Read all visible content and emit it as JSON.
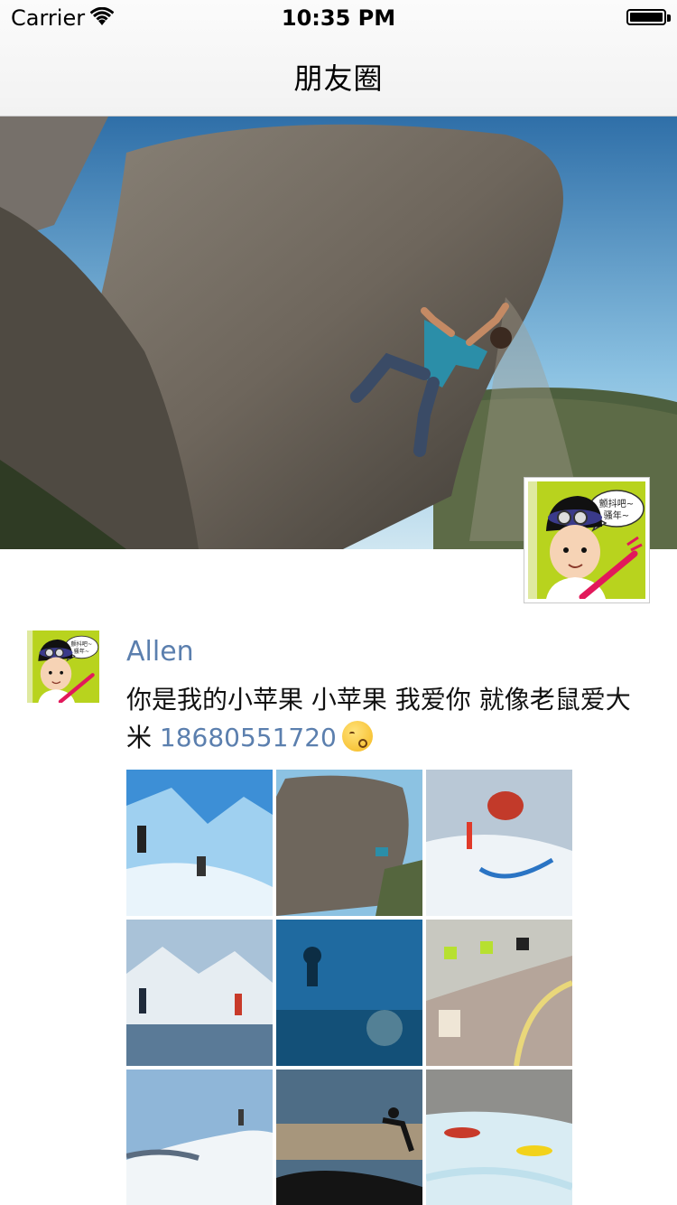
{
  "status_bar": {
    "carrier": "Carrier",
    "time": "10:35 PM"
  },
  "nav": {
    "title": "朋友圈"
  },
  "cover": {
    "avatar_bubble_line1": "颤抖吧~",
    "avatar_bubble_line2": "骚年~"
  },
  "post": {
    "author": "Allen",
    "text": "你是我的小苹果 小苹果 我爱你 就像老鼠爱大米 ",
    "phone": "18680551720",
    "emoji": "kissing-face"
  },
  "colors": {
    "link": "#5b7fae",
    "avatar_bg": "#b8d31e"
  }
}
